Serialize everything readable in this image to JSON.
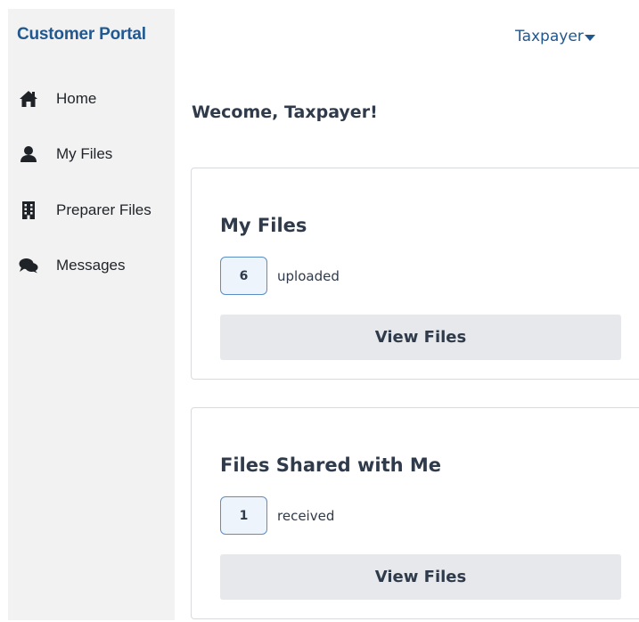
{
  "sidebar": {
    "brand": "Customer Portal",
    "items": [
      {
        "label": "Home",
        "icon": "home-icon"
      },
      {
        "label": "My Files",
        "icon": "user-icon"
      },
      {
        "label": "Preparer Files",
        "icon": "building-icon"
      },
      {
        "label": "Messages",
        "icon": "comments-icon"
      }
    ]
  },
  "header": {
    "user_menu_label": "Taxpayer",
    "user_menu_icon": "caret-down-icon"
  },
  "main": {
    "welcome": "Wecome, Taxpayer!",
    "cards": [
      {
        "title": "My Files",
        "count": "6",
        "count_text": "uploaded",
        "button": "View Files"
      },
      {
        "title": "Files Shared with Me",
        "count": "1",
        "count_text": "received",
        "button": "View Files"
      }
    ]
  },
  "colors": {
    "brand": "#21588f",
    "sidebar_bg": "#f2f2f2",
    "text": "#2f3a4a",
    "button_bg": "#e6e8eb",
    "badge_border": "#5b8ec2"
  }
}
